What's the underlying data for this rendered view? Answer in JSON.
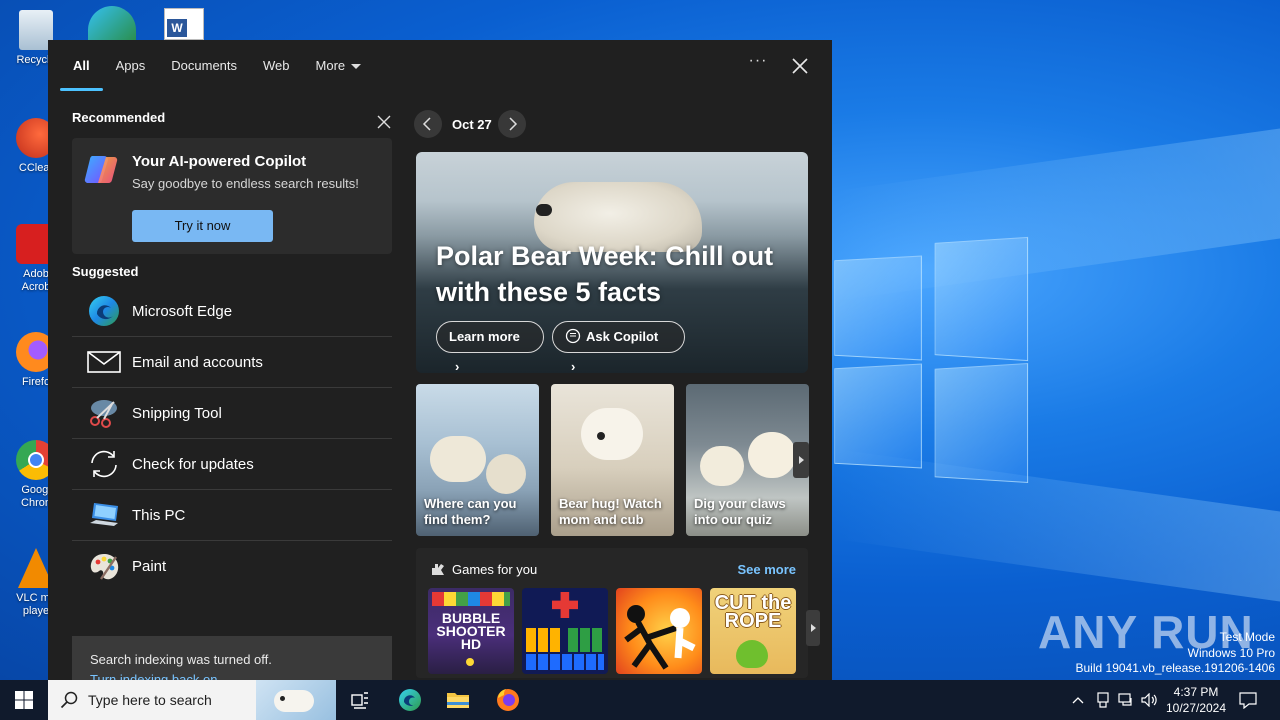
{
  "desktop": {
    "icons": [
      {
        "label": "Recycle"
      },
      {
        "label": "CClear"
      },
      {
        "label": "Adob Acrob"
      },
      {
        "label": "Firefo"
      },
      {
        "label": "Googl Chron"
      },
      {
        "label": "VLC me playe"
      }
    ],
    "watermark": "ANY RUN",
    "test_mode": {
      "line1": "Test Mode",
      "line2": "Windows 10 Pro",
      "line3": "Build 19041.vb_release.191206-1406"
    }
  },
  "panel": {
    "tabs": [
      {
        "label": "All"
      },
      {
        "label": "Apps"
      },
      {
        "label": "Documents"
      },
      {
        "label": "Web"
      },
      {
        "label": "More"
      }
    ],
    "recommended": {
      "title": "Recommended",
      "copilot_title": "Your AI-powered Copilot",
      "copilot_subtitle": "Say goodbye to endless search results!",
      "try_button": "Try it now"
    },
    "suggested": {
      "title": "Suggested",
      "items": [
        {
          "label": "Microsoft Edge",
          "icon": "edge-icon"
        },
        {
          "label": "Email and accounts",
          "icon": "mail-icon"
        },
        {
          "label": "Snipping Tool",
          "icon": "scissors-icon"
        },
        {
          "label": "Check for updates",
          "icon": "refresh-icon"
        },
        {
          "label": "This PC",
          "icon": "computer-icon"
        },
        {
          "label": "Paint",
          "icon": "palette-icon"
        }
      ]
    },
    "indexing": {
      "text": "Search indexing was turned off.",
      "link": "Turn indexing back on."
    },
    "highlights": {
      "date": "Oct 27",
      "hero_title": "Polar Bear Week: Chill out with these 5 facts",
      "learn_more": "Learn more",
      "ask_copilot": "Ask Copilot",
      "cards": [
        {
          "text": "Where can you find them?"
        },
        {
          "text": "Bear hug! Watch mom and cub"
        },
        {
          "text": "Dig your claws into our quiz"
        }
      ],
      "games_title": "Games for you",
      "games_more": "See more",
      "games": [
        {
          "name": "Bubble Shooter HD",
          "label": "BUBBLE SHOOTER HD"
        },
        {
          "name": "Block puzzle"
        },
        {
          "name": "Stickman fight"
        },
        {
          "name": "Cut the Rope",
          "label": "CUT the ROPE"
        }
      ]
    }
  },
  "taskbar": {
    "search_placeholder": "Type here to search",
    "time": "4:37 PM",
    "date": "10/27/2024"
  },
  "colors": {
    "panel_bg": "#202020",
    "accent": "#4cc2ff",
    "link": "#79c4ff",
    "button": "#79b8f3",
    "taskbar": "#101a2c"
  }
}
